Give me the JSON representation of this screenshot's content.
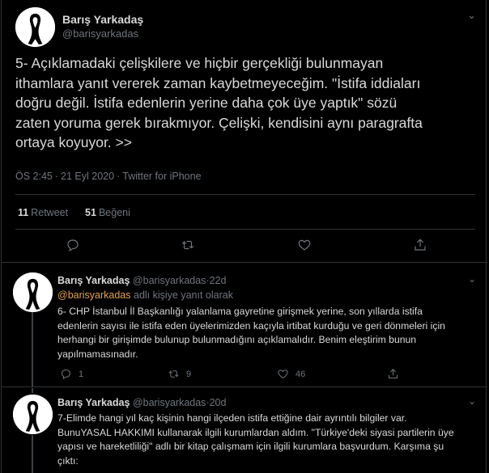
{
  "main_tweet": {
    "author_name": "Barış Yarkadaş",
    "author_handle": "@barisyarkadas",
    "text": "5- Açıklamadaki çelişkilere ve hiçbir gerçekliği bulunmayan\nithamlara yanıt vererek zaman kaybetmeyeceğim. \"İstifa iddiaları\ndoğru değil. İstifa edenlerin yerine daha çok üye yaptık\" sözü\nzaten yoruma gerek bırakmıyor. Çelişki, kendisini aynı paragrafta\nortaya koyuyor. >>",
    "time": "ÖS 2:45",
    "date": "21 Eyl 2020",
    "dot": "·",
    "client": "Twitter for iPhone",
    "retweet_count": "11",
    "retweet_label": "Retweet",
    "like_count": "51",
    "like_label": "Beğeni"
  },
  "replies": [
    {
      "author_name": "Barış Yarkadaş",
      "author_handle": "@barisyarkadas",
      "age": "22d",
      "dot": "·",
      "replying_mention": "@barisyarkadas",
      "replying_suffix": " adlı kişiye yanıt olarak",
      "text": "6- CHP İstanbul İl Başkanlığı yalanlama gayretine girişmek yerine, son yıllarda istifa\nedenlerin sayısı ile istifa eden üyelerimizden kaçıyla irtibat kurduğu ve geri dönmeleri için\nherhangi bir girişimde bulunup bulunmadığını açıklamalıdır. Benim eleştirim bunun\nyapılmamasınadır.",
      "reply_count": "1",
      "retweet_count": "9",
      "like_count": "46"
    },
    {
      "author_name": "Barış Yarkadaş",
      "author_handle": "@barisyarkadas",
      "age": "20d",
      "dot": "·",
      "text": "7-Elimde hangi yıl kaç kişinin hangi ilçeden istifa ettiğine dair ayrıntılı bilgiler var.\nBunuYASAL HAKKIMI kullanarak ilgili kurumlardan aldım. \"Türkiye'deki siyasi partilerin üye\nyapısı ve hareketliliği\" adlı bir kitap çalışmam için ilgili kurumlara başvurdum. Karşıma şu\nçıktı:"
    }
  ],
  "icons": {
    "caret": "chevron-down-icon",
    "reply": "reply-icon",
    "retweet": "retweet-icon",
    "like": "heart-icon",
    "share": "share-icon"
  },
  "colors": {
    "background": "#000000",
    "text": "#d9d9d9",
    "muted": "#6e767d",
    "mention": "#e2a24a",
    "divider": "#2f3336"
  }
}
